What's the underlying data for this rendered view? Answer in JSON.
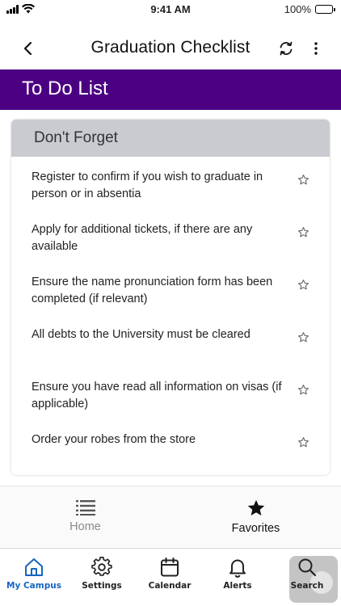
{
  "status_bar": {
    "time": "9:41 AM",
    "battery": "100%"
  },
  "nav": {
    "title": "Graduation Checklist",
    "back_icon": "chevron-left-icon",
    "refresh_icon": "refresh-icon",
    "more_icon": "more-vertical-icon"
  },
  "banner": {
    "title": "To Do List",
    "color": "#4b0082"
  },
  "card": {
    "header": "Don't Forget",
    "items": [
      {
        "text": "Register to confirm if you wish to graduate in person or in absentia"
      },
      {
        "text": "Apply for additional tickets, if there are any available"
      },
      {
        "text": "Ensure the name pronunciation form has been completed (if relevant)"
      },
      {
        "text": "All debts to the University must be cleared"
      },
      {
        "text": "Ensure you have read all information on visas (if applicable)"
      },
      {
        "text": "Order your robes from the store"
      }
    ]
  },
  "home_fav": {
    "home": {
      "label": "Home",
      "icon": "list-icon"
    },
    "favorites": {
      "label": "Favorites",
      "icon": "star-icon"
    }
  },
  "tabs": [
    {
      "label": "My Campus",
      "icon": "home-icon",
      "active": true
    },
    {
      "label": "Settings",
      "icon": "gear-icon"
    },
    {
      "label": "Calendar",
      "icon": "calendar-icon"
    },
    {
      "label": "Alerts",
      "icon": "bell-icon"
    },
    {
      "label": "Search",
      "icon": "search-icon"
    }
  ],
  "colors": {
    "accent": "#1565c0",
    "banner": "#4b0082",
    "card_header": "#c9cbd0"
  }
}
